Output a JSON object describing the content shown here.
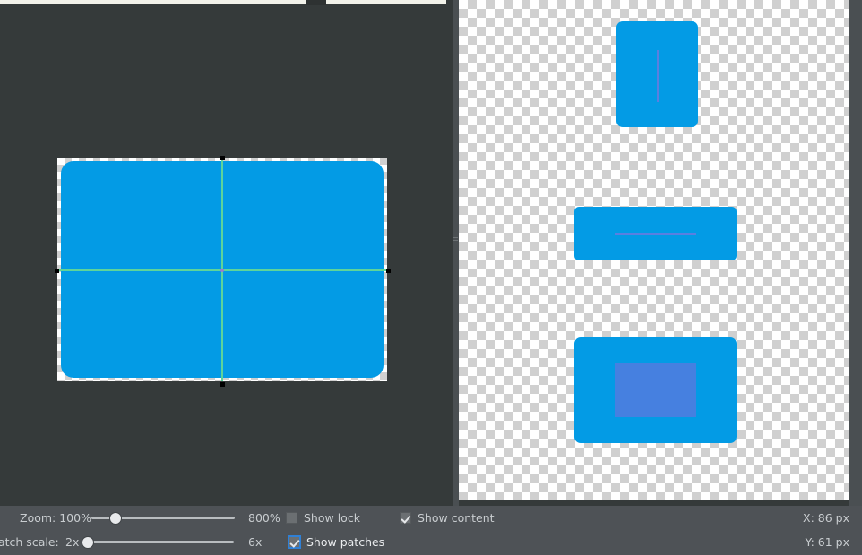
{
  "window": {
    "background_color": "#353a3a",
    "toolbar_color": "#4e5256"
  },
  "canvas": {
    "name": "artboard-canvas",
    "shape_color": "#039BE5",
    "guide_color": "#5ed49a",
    "handle_color": "#000000",
    "center_dot_color": "#9a7bd0"
  },
  "patches": {
    "panel_name": "patch-preview-panel",
    "items": [
      {
        "name": "patch-preview-1",
        "color": "#039BE5",
        "mark_color": "#5b7fe0",
        "mark_shape": "vertical-line"
      },
      {
        "name": "patch-preview-2",
        "color": "#039BE5",
        "mark_color": "#5b7fe0",
        "mark_shape": "horizontal-line"
      },
      {
        "name": "patch-preview-3",
        "color": "#039BE5",
        "mark_color": "#4680e0",
        "mark_shape": "filled-rect"
      }
    ]
  },
  "toolbar": {
    "zoom": {
      "label": "Zoom: 100%",
      "max_label": "800%",
      "value_percent": 100,
      "thumb_position_percent": 17
    },
    "patch_scale": {
      "label": "Patch scale:",
      "min_label": "2x",
      "max_label": "6x",
      "value": "2x",
      "thumb_position_percent": 0
    },
    "checkboxes": [
      {
        "name": "show-lock-checkbox",
        "label": "Show lock",
        "checked": false,
        "focused": false
      },
      {
        "name": "show-content-checkbox",
        "label": "Show content",
        "checked": true,
        "focused": false
      },
      {
        "name": "show-patches-checkbox",
        "label": "Show patches",
        "checked": true,
        "focused": true
      }
    ],
    "coordinates": {
      "x": "X: 86 px",
      "y": "Y: 61 px"
    }
  }
}
